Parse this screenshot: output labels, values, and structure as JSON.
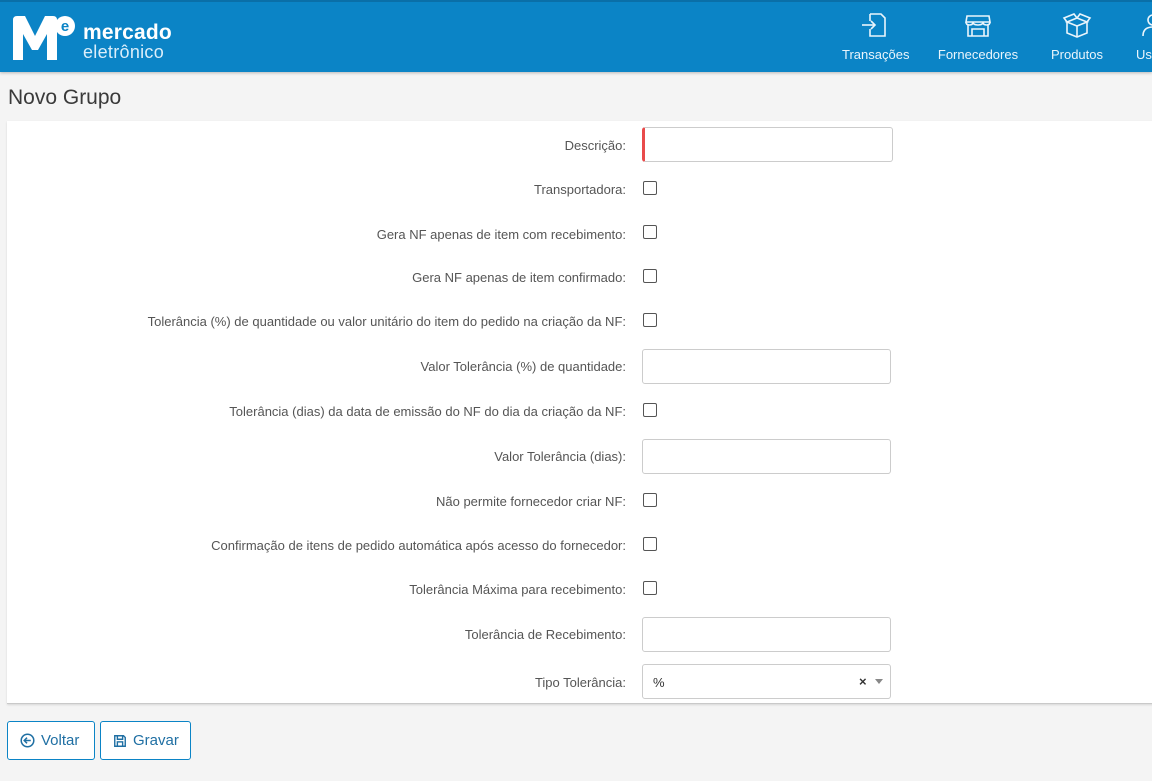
{
  "header": {
    "logo_line1": "mercado",
    "logo_line2": "eletrônico",
    "nav": [
      {
        "label": "Transações",
        "icon": "transactions-icon"
      },
      {
        "label": "Fornecedores",
        "icon": "store-icon"
      },
      {
        "label": "Produtos",
        "icon": "box-icon"
      },
      {
        "label": "Usu",
        "icon": "user-icon"
      }
    ],
    "colors": {
      "bar": "#0b84c6"
    }
  },
  "page": {
    "title": "Novo Grupo"
  },
  "form": {
    "descricao_label": "Descrição:",
    "descricao_value": "",
    "transportadora_label": "Transportadora:",
    "gera_nf_recebimento_label": "Gera NF apenas de item com recebimento:",
    "gera_nf_confirmado_label": "Gera NF apenas de item confirmado:",
    "tolerancia_qtd_label": "Tolerância (%) de quantidade ou valor unitário do item do pedido na criação da NF:",
    "valor_tolerancia_qtd_label": "Valor Tolerância (%) de quantidade:",
    "valor_tolerancia_qtd_value": "",
    "tolerancia_dias_label": "Tolerância (dias) da data de emissão do NF do dia da criação da NF:",
    "valor_tolerancia_dias_label": "Valor Tolerância (dias):",
    "valor_tolerancia_dias_value": "",
    "nao_permite_fornecedor_label": "Não permite fornecedor criar NF:",
    "confirmacao_automatica_label": "Confirmação de itens de pedido automática após acesso do fornecedor:",
    "tolerancia_maxima_label": "Tolerância Máxima para recebimento:",
    "tolerancia_recebimento_label": "Tolerância de Recebimento:",
    "tolerancia_recebimento_value": "",
    "tipo_tolerancia_label": "Tipo Tolerância:",
    "tipo_tolerancia_value": "%",
    "tipo_tolerancia_clear": "×"
  },
  "actions": {
    "voltar_label": "Voltar",
    "gravar_label": "Gravar"
  }
}
